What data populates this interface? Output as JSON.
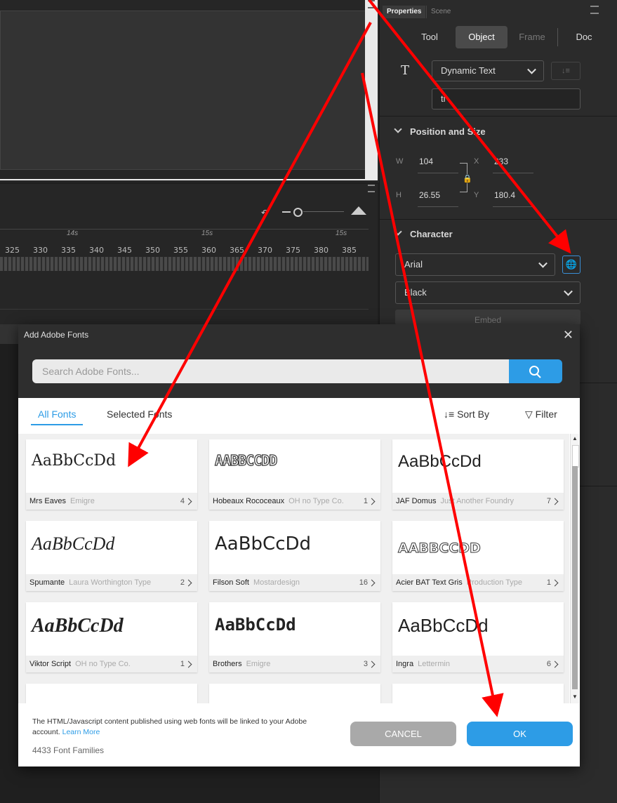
{
  "properties": {
    "tabs": [
      "Properties",
      "Scene"
    ],
    "segments": [
      "Tool",
      "Object",
      "Frame",
      "Doc"
    ],
    "text_type": "Dynamic Text",
    "instance_name": "ti",
    "position_size": {
      "title": "Position and Size",
      "w_label": "W",
      "w": "104",
      "h_label": "H",
      "h": "26.55",
      "x_label": "X",
      "x": "233",
      "y_label": "Y",
      "y": "180.4"
    },
    "character": {
      "title": "Character",
      "font_family": "Arial",
      "font_style": "Black",
      "embed_label": "Embed"
    }
  },
  "timeline": {
    "seconds": [
      "14s",
      "15s",
      "15s"
    ],
    "frames": [
      "325",
      "330",
      "335",
      "340",
      "345",
      "350",
      "355",
      "360",
      "365",
      "370",
      "375",
      "380",
      "385"
    ]
  },
  "dialog": {
    "title": "Add Adobe Fonts",
    "search_placeholder": "Search Adobe Fonts...",
    "tabs": {
      "all": "All Fonts",
      "selected": "Selected Fonts"
    },
    "sort_label": "Sort By",
    "filter_label": "Filter",
    "sample_text": "AaBbCcDd",
    "sample_caps": "AABBCCDD",
    "fonts": [
      {
        "name": "Mrs Eaves",
        "foundry": "Emigre",
        "count": "4"
      },
      {
        "name": "Hobeaux Rococeaux",
        "foundry": "OH no Type Co.",
        "count": "1"
      },
      {
        "name": "JAF Domus",
        "foundry": "Just Another Foundry",
        "count": "7"
      },
      {
        "name": "Spumante",
        "foundry": "Laura Worthington Type",
        "count": "2"
      },
      {
        "name": "Filson Soft",
        "foundry": "Mostardesign",
        "count": "16"
      },
      {
        "name": "Acier BAT Text Gris",
        "foundry": "Production Type",
        "count": "1"
      },
      {
        "name": "Viktor Script",
        "foundry": "OH no Type Co.",
        "count": "1"
      },
      {
        "name": "Brothers",
        "foundry": "Emigre",
        "count": "3"
      },
      {
        "name": "Ingra",
        "foundry": "Lettermin",
        "count": "6"
      }
    ],
    "notice": "The HTML/Javascript content published using web fonts will be linked to your Adobe account.",
    "learn_more": "Learn More",
    "family_count": "4433 Font Families",
    "cancel_label": "CANCEL",
    "ok_label": "OK"
  },
  "colors": {
    "accent": "#2d9ce6",
    "arrow": "#ff0000"
  }
}
